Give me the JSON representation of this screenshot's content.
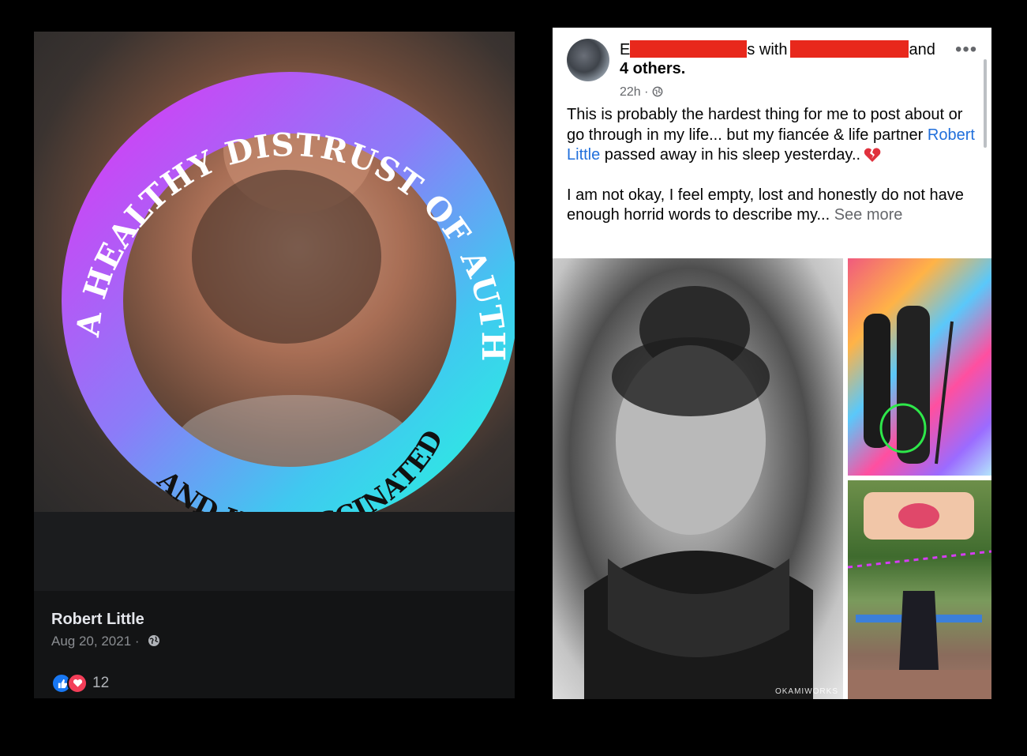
{
  "left_post": {
    "frame_text_top": "I HAVE A HEALTHY DISTRUST OF AUTHORITY",
    "frame_text_bottom": "AND I'M VACCINATED",
    "author": "Robert Little",
    "date": "Aug 20, 2021 ·",
    "reaction_count": "12",
    "icons": [
      "globe-icon",
      "like-icon",
      "love-icon"
    ]
  },
  "right_post": {
    "header_visible_1": "E",
    "header_visible_2": "s with",
    "header_visible_3": "and",
    "header_others": "4 others.",
    "time": "22h ·",
    "text_p1_a": "This is probably the hardest thing for me to post about or go through in my life... but my fiancée & life partner ",
    "mention": "Robert Little",
    "text_p1_b": " passed away in his sleep yesterday..",
    "text_p2": "I am not okay, I feel empty, lost and honestly do not have enough horrid words to describe my...",
    "see_more": "See more",
    "more_label": "•••",
    "watermark": "OKAMIWORKS",
    "icons": [
      "more-icon",
      "globe-icon",
      "broken-heart-icon"
    ],
    "redaction_color": "#e8281c"
  }
}
